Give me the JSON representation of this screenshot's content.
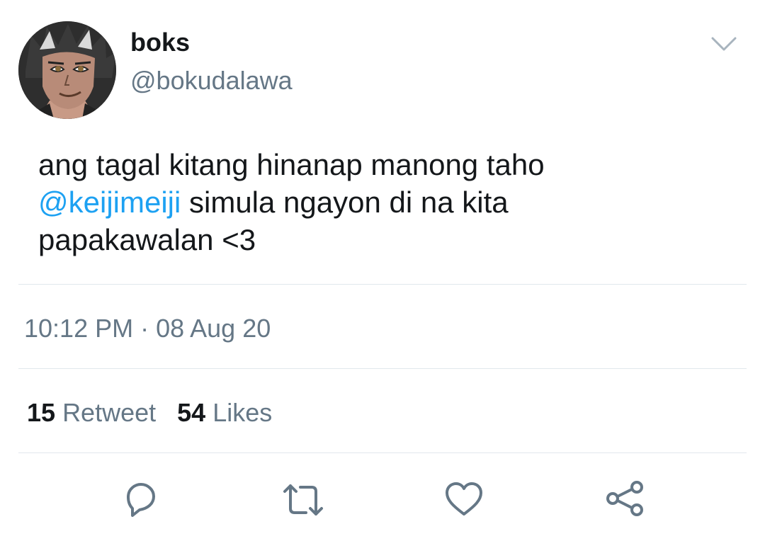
{
  "tweet": {
    "display_name": "boks",
    "handle": "@bokudalawa",
    "text_line1": "ang tagal kitang hinanap manong taho",
    "mention": "@keijimeiji",
    "text_line2_rest": " simula ngayon di na kita",
    "text_line3": "papakawalan <3",
    "timestamp": "10:12 PM · 08 Aug 20"
  },
  "stats": {
    "retweets_count": "15",
    "retweets_label": "Retweet",
    "likes_count": "54",
    "likes_label": "Likes"
  },
  "icons": {
    "menu": "chevron-down-icon",
    "reply": "reply-icon",
    "retweet": "retweet-icon",
    "like": "heart-icon",
    "share": "share-icon"
  },
  "colors": {
    "text": "#14171a",
    "secondary": "#657786",
    "link": "#1da1f2",
    "divider": "#e1e8ed"
  }
}
